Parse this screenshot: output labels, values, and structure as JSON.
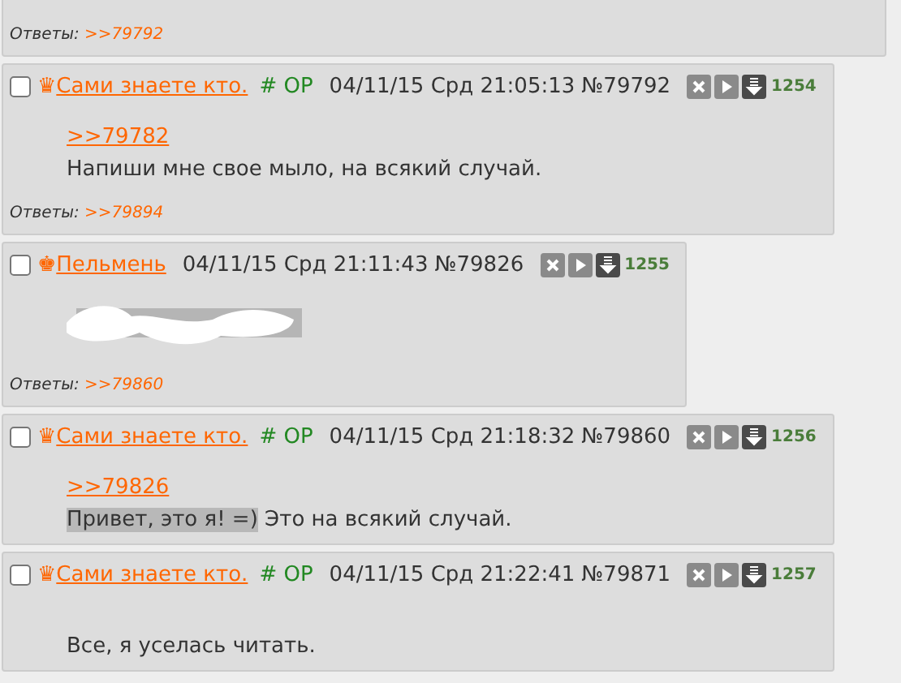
{
  "top_post": {
    "replies_label": "Ответы:",
    "replies": [
      ">>79792"
    ]
  },
  "posts": [
    {
      "checked": false,
      "crown": "♛",
      "name": "Сами знаете кто.",
      "trip": "# OP",
      "date": "04/11/15 Срд 21:05:13",
      "number": "№79792",
      "count": "1254",
      "body": [
        {
          "kind": "link",
          "text": ">>79782"
        },
        {
          "kind": "text",
          "segments": [
            {
              "text": "Напиши мне свое мыло, на всякий случай.",
              "highlighted": false
            }
          ]
        }
      ],
      "replies_label": "Ответы:",
      "replies": [
        ">>79894"
      ]
    },
    {
      "checked": false,
      "crown": "♚",
      "name": "Пельмень",
      "date": "04/11/15 Срд 21:11:43",
      "number": "№79826",
      "count": "1255",
      "body": [
        {
          "kind": "redacted"
        }
      ],
      "replies_label": "Ответы:",
      "replies": [
        ">>79860"
      ]
    },
    {
      "checked": false,
      "crown": "♛",
      "name": "Сами знаете кто.",
      "trip": "# OP",
      "date": "04/11/15 Срд 21:18:32",
      "number": "№79860",
      "count": "1256",
      "body": [
        {
          "kind": "link",
          "text": ">>79826"
        },
        {
          "kind": "text",
          "segments": [
            {
              "text": "Привет, это я! =)",
              "highlighted": true
            },
            {
              "text": " Это на всякий случай.",
              "highlighted": false
            }
          ]
        }
      ]
    },
    {
      "checked": false,
      "crown": "♛",
      "name": "Сами знаете кто.",
      "trip": "# OP",
      "date": "04/11/15 Срд 21:22:41",
      "number": "№79871",
      "count": "1257",
      "body": [
        {
          "kind": "blank"
        },
        {
          "kind": "text",
          "segments": [
            {
              "text": "Все, я уселась читать.",
              "highlighted": false
            }
          ]
        }
      ]
    }
  ]
}
